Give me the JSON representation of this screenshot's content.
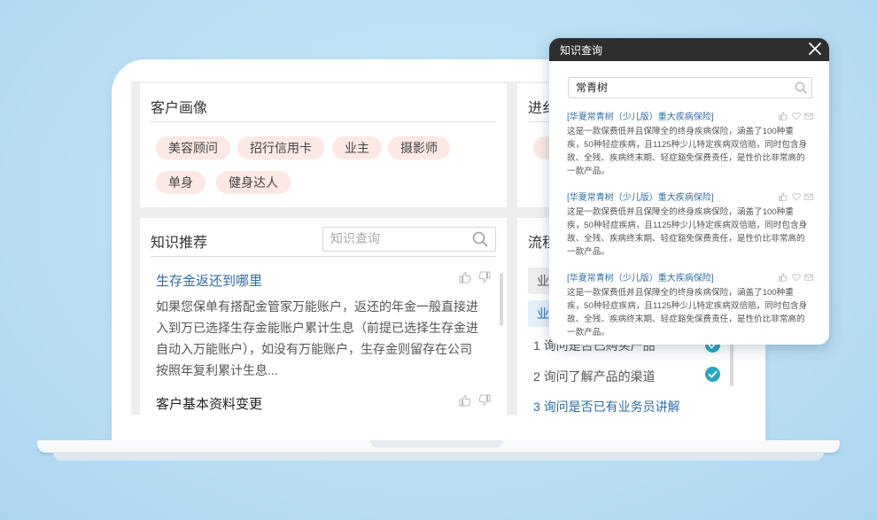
{
  "portrait": {
    "title": "客户画像",
    "tags": [
      "美容顾问",
      "招行信用卡",
      "业主",
      "摄影师",
      "单身",
      "健身达人"
    ]
  },
  "progress": {
    "title": "进纟"
  },
  "knowledge": {
    "title": "知识推荐",
    "search_placeholder": "知识查询",
    "items": [
      {
        "title": "生存金返还到哪里",
        "lines": [
          "如果您保单有搭配金管家万能账户，返还的年金一般直接进",
          "入到万已选择生存金能账户累计生息（前提已选择生存金进",
          "自动入万能账户），如没有万能账户，生存金则留存在公司",
          "按照年复利累计生息..."
        ]
      },
      {
        "title": "客户基本资料变更"
      }
    ]
  },
  "flow": {
    "title": "流程",
    "chips": [
      "业",
      "业"
    ],
    "items": [
      {
        "label": "1 询问是否已购买产品",
        "done": true
      },
      {
        "label": "2 询问了解产品的渠道",
        "done": true
      },
      {
        "label": "3 询问是否已有业务员讲解",
        "done": false
      }
    ]
  },
  "popup": {
    "title": "知识查询",
    "search_value": "常青树",
    "results": [
      {
        "title": "[华夏常青树（少儿版）重大疾病保险]",
        "lines": [
          "这是一款保费低并且保障全的终身疾病保险，涵盖了100种重",
          "疾，50种轻症疾病，且1125种少儿特定疾病双倍赔，同时包含身",
          "故、全残、疾病终末期、轻症豁免保费责任，是性价比非常高的",
          "一款产品。"
        ]
      },
      {
        "title": "[华夏常青树（少儿版）重大疾病保险]",
        "lines": [
          "这是一款保费低并且保障全的终身疾病保险，涵盖了100种重",
          "疾，50种轻症疾病，且1125种少儿特定疾病双倍赔，同时包含身",
          "故、全残、疾病终末期、轻症豁免保费责任，是性价比非常高的",
          "一款产品。"
        ]
      },
      {
        "title": "[华夏常青树（少儿版）重大疾病保险]",
        "lines": [
          "这是一款保费低并且保障全的终身疾病保险，涵盖了100种重",
          "疾，50种轻症疾病，且1125种少儿特定疾病双倍赔，同时包含身",
          "故、全残、疾病终末期、轻症豁免保费责任，是性价比非常高的",
          "一款产品。"
        ]
      }
    ]
  },
  "colors": {
    "background": "#bfe3f6",
    "tag_bg": "#fde8e4",
    "link_blue": "#2e6da4",
    "check_teal": "#2ba6be",
    "popup_header": "#2e2e2e"
  },
  "icons": [
    "search-icon",
    "thumbs-up-icon",
    "thumbs-down-icon",
    "check-circle-icon",
    "close-icon",
    "heart-icon",
    "mail-icon"
  ]
}
